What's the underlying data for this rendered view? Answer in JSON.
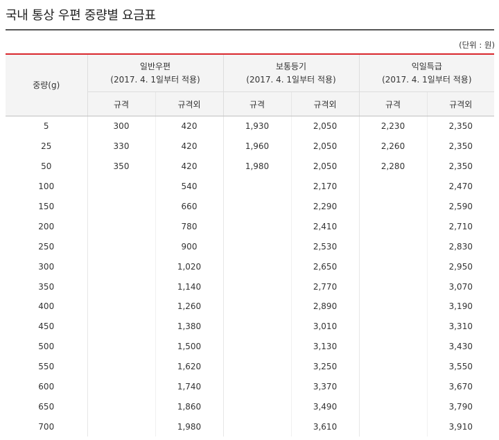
{
  "page": {
    "title": "국내 통상 우편 중량별 요금표",
    "unit_note": "(단위 : 원)"
  },
  "table": {
    "weight_header": "중량(g)",
    "groups": [
      {
        "name": "일반우편",
        "note": "(2017. 4. 1일부터 적용)"
      },
      {
        "name": "보통등기",
        "note": "(2017. 4. 1일부터 적용)"
      },
      {
        "name": "익일특급",
        "note": "(2017. 4. 1일부터 적용)"
      }
    ],
    "sub_headers": [
      "규격",
      "규격외",
      "규격",
      "규격외",
      "규격",
      "규격외"
    ],
    "rows": [
      [
        "5",
        "300",
        "420",
        "1,930",
        "2,050",
        "2,230",
        "2,350"
      ],
      [
        "25",
        "330",
        "420",
        "1,960",
        "2,050",
        "2,260",
        "2,350"
      ],
      [
        "50",
        "350",
        "420",
        "1,980",
        "2,050",
        "2,280",
        "2,350"
      ],
      [
        "100",
        "",
        "540",
        "",
        "2,170",
        "",
        "2,470"
      ],
      [
        "150",
        "",
        "660",
        "",
        "2,290",
        "",
        "2,590"
      ],
      [
        "200",
        "",
        "780",
        "",
        "2,410",
        "",
        "2,710"
      ],
      [
        "250",
        "",
        "900",
        "",
        "2,530",
        "",
        "2,830"
      ],
      [
        "300",
        "",
        "1,020",
        "",
        "2,650",
        "",
        "2,950"
      ],
      [
        "350",
        "",
        "1,140",
        "",
        "2,770",
        "",
        "3,070"
      ],
      [
        "400",
        "",
        "1,260",
        "",
        "2,890",
        "",
        "3,190"
      ],
      [
        "450",
        "",
        "1,380",
        "",
        "3,010",
        "",
        "3,310"
      ],
      [
        "500",
        "",
        "1,500",
        "",
        "3,130",
        "",
        "3,430"
      ],
      [
        "550",
        "",
        "1,620",
        "",
        "3,250",
        "",
        "3,550"
      ],
      [
        "600",
        "",
        "1,740",
        "",
        "3,370",
        "",
        "3,670"
      ],
      [
        "650",
        "",
        "1,860",
        "",
        "3,490",
        "",
        "3,790"
      ],
      [
        "700",
        "",
        "1,980",
        "",
        "3,610",
        "",
        "3,910"
      ]
    ]
  },
  "colors": {
    "accent_border": "#d9262c",
    "header_bg": "#f4f4f4",
    "title_rule": "#555555"
  }
}
